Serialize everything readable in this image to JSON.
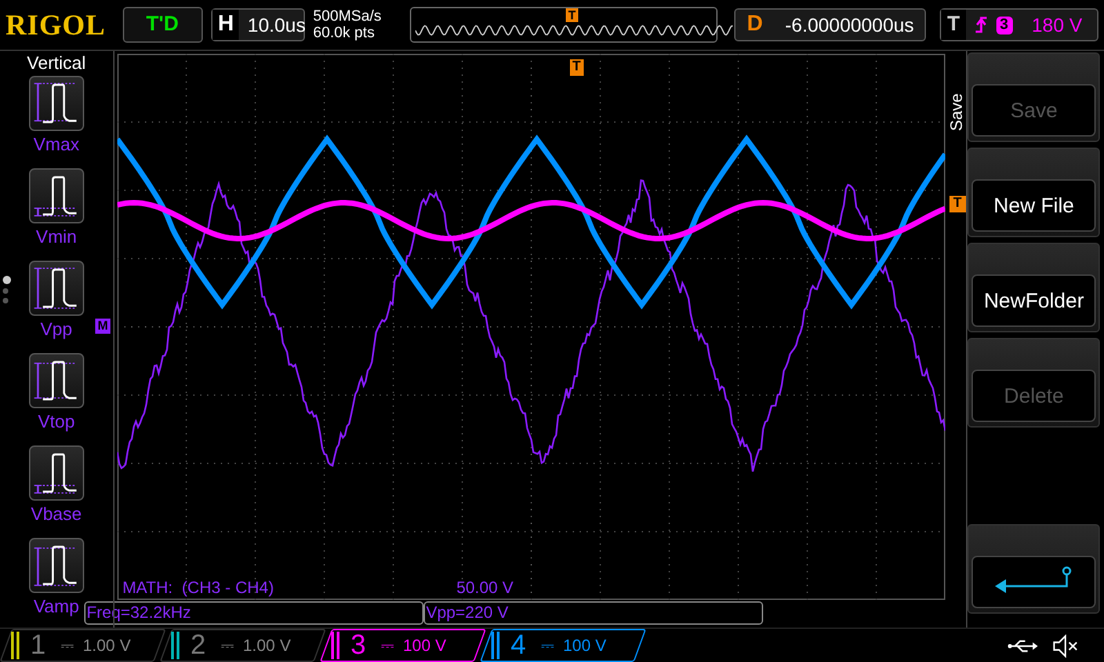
{
  "brand": "RIGOL",
  "run_status": "T'D",
  "horizontal": {
    "label": "H",
    "timebase": "10.0us",
    "sample_rate": "500MSa/s",
    "memory_depth": "60.0k pts",
    "trigger_marker": "T"
  },
  "delay": {
    "label": "D",
    "value": "-6.00000000us"
  },
  "trigger": {
    "label": "T",
    "source": "3",
    "level": "180 V",
    "color": "#ff00ff"
  },
  "screen_markers": {
    "trigger_position": "T",
    "trigger_level": "T",
    "math": "M"
  },
  "left_menu": {
    "title": "Vertical",
    "items": [
      {
        "label": "Vmax",
        "kind": "vmax"
      },
      {
        "label": "Vmin",
        "kind": "vmin"
      },
      {
        "label": "Vpp",
        "kind": "vpp"
      },
      {
        "label": "Vtop",
        "kind": "vtop"
      },
      {
        "label": "Vbase",
        "kind": "vbase"
      },
      {
        "label": "Vamp",
        "kind": "vamp"
      }
    ],
    "pages": [
      {
        "selected": true
      },
      {
        "selected": false
      },
      {
        "selected": false
      }
    ]
  },
  "math": {
    "label": "MATH:  (CH3 - CH4)",
    "scale": "50.00 V"
  },
  "measurements": [
    "Freq=32.2kHz",
    "Vpp=220 V"
  ],
  "right_menu": {
    "title": "Save",
    "buttons": [
      {
        "label": "Save",
        "disabled": true
      },
      {
        "label": "New File",
        "disabled": false
      },
      {
        "label": "NewFolder",
        "disabled": false
      },
      {
        "label": "Delete",
        "disabled": true
      }
    ]
  },
  "channels": [
    {
      "number": "1",
      "coupling": "⎓",
      "scale": "1.00 V",
      "on": false,
      "color": "#c8c800"
    },
    {
      "number": "2",
      "coupling": "⎓",
      "scale": "1.00 V",
      "on": false,
      "color": "#00b4b4"
    },
    {
      "number": "3",
      "coupling": "⎓",
      "scale": "100 V",
      "on": true,
      "color": "#ff00ff"
    },
    {
      "number": "4",
      "coupling": "⎓",
      "scale": "100 V",
      "on": true,
      "color": "#0090ff"
    }
  ]
}
